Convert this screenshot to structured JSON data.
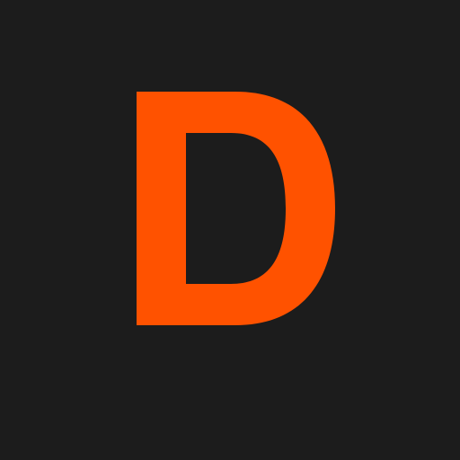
{
  "icon": {
    "letter": "D",
    "name": "letter-d-icon",
    "background_color": "#1c1c1c",
    "accent_color": "#ff5200"
  }
}
